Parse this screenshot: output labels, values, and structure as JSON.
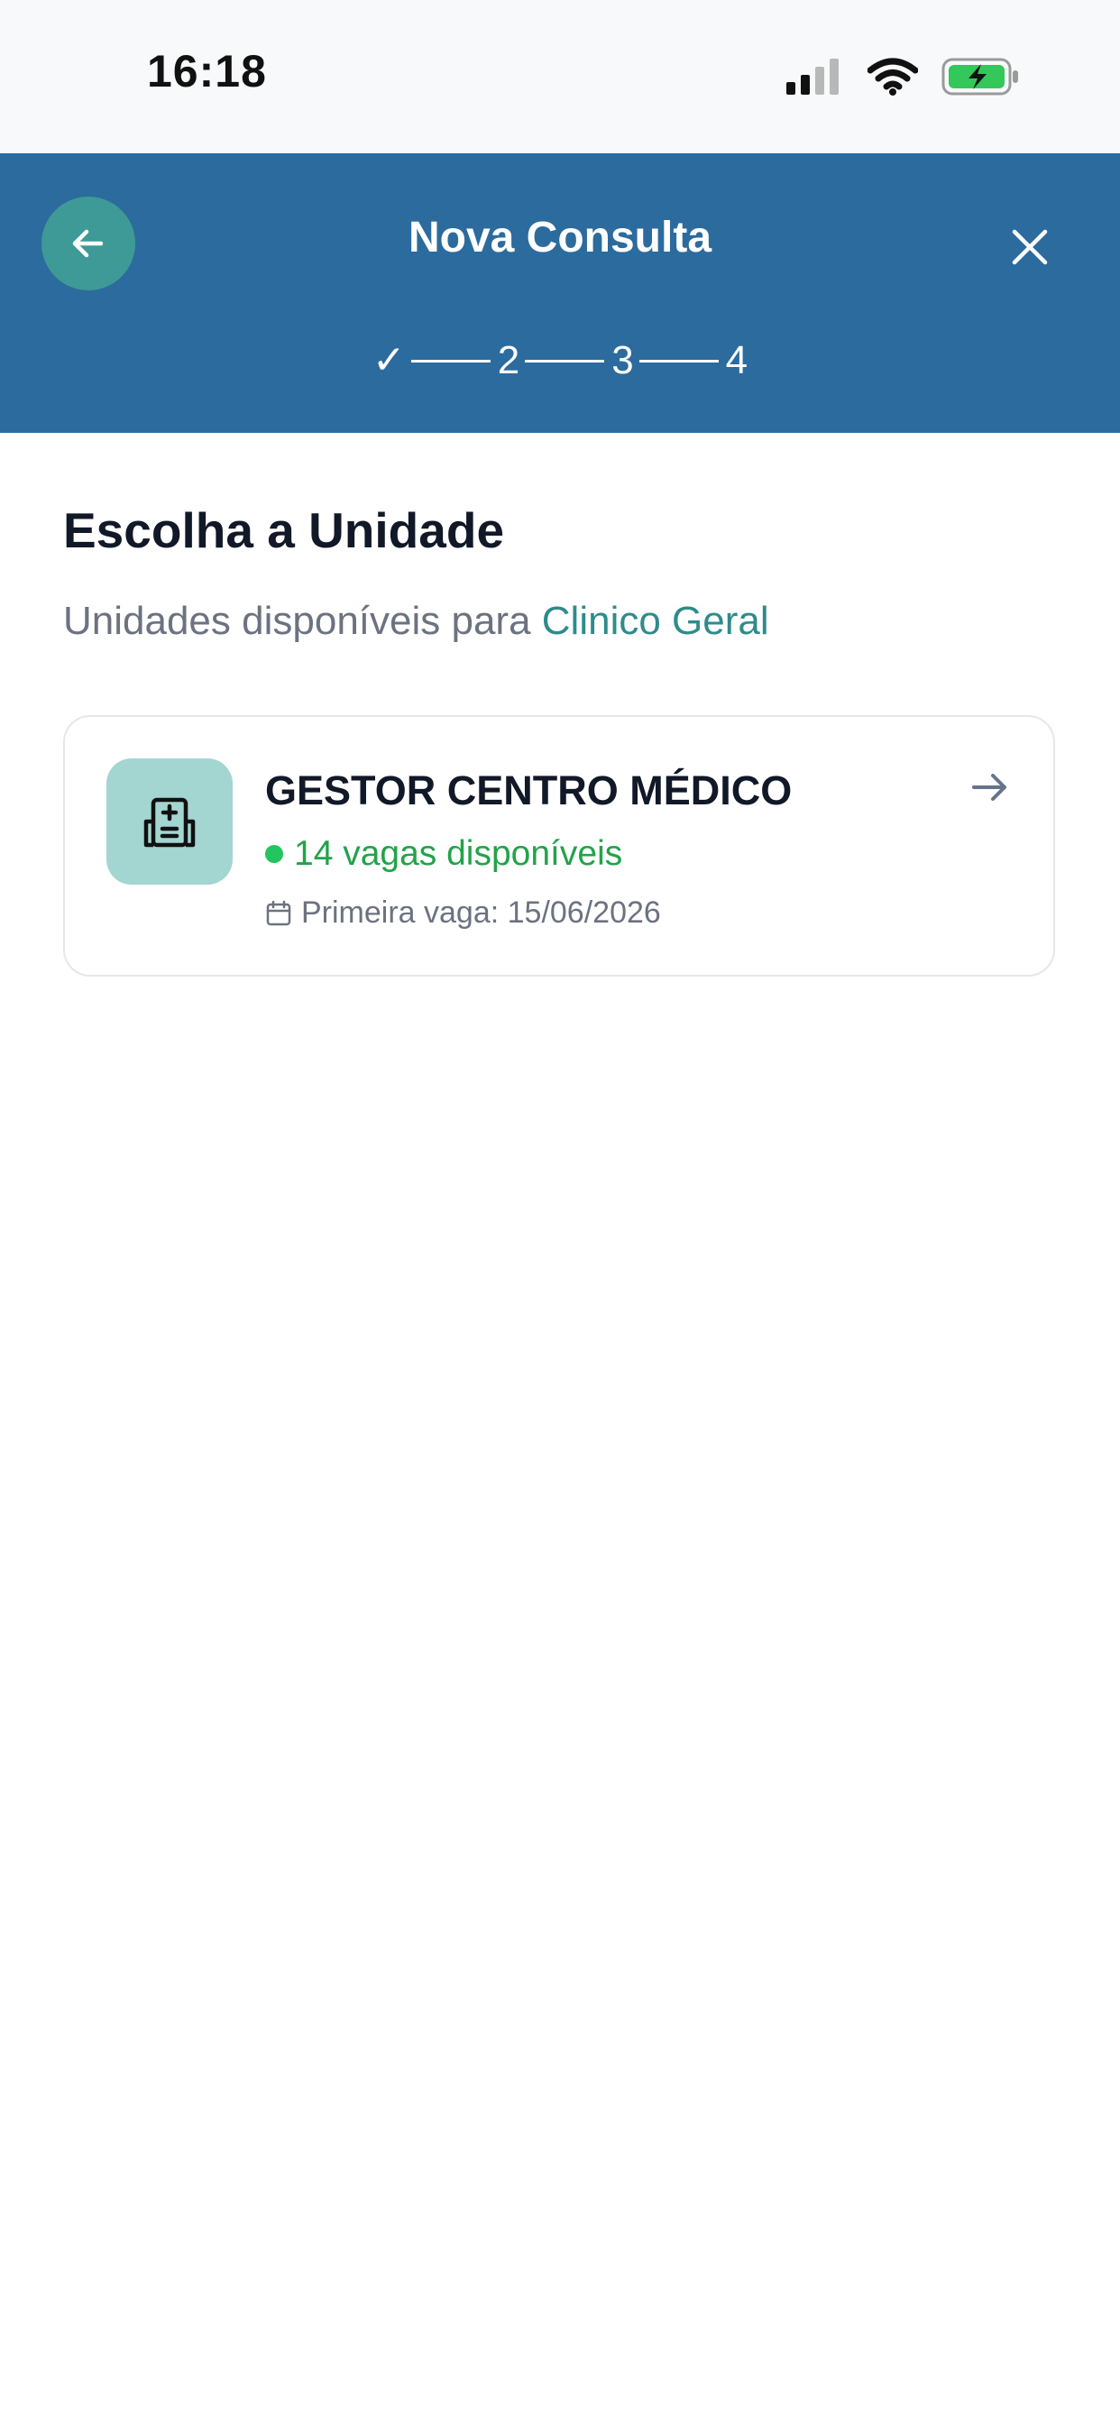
{
  "status_bar": {
    "time": "16:18",
    "icons": [
      "cellular-signal-icon",
      "wifi-icon",
      "battery-charging-icon"
    ]
  },
  "header": {
    "title": "Nova Consulta",
    "back_icon": "arrow-left-icon",
    "close_icon": "close-icon",
    "steps": [
      "✓",
      "2",
      "3",
      "4"
    ],
    "background_color": "#2c6b9e",
    "back_button_color": "#3d9a97"
  },
  "main": {
    "title": "Escolha a Unidade",
    "subtitle_prefix": "Unidades disponíveis para ",
    "subtitle_specialty": "Clinico Geral",
    "units": [
      {
        "name": "GESTOR CENTRO MÉDICO",
        "slots": "14 vagas disponíveis",
        "first_slot": "Primeira vaga: 15/06/2026",
        "icon": "hospital-icon",
        "arrow_icon": "arrow-right-icon"
      }
    ]
  },
  "colors": {
    "accent": "#2e8b8b",
    "available": "#22a34a",
    "unit_icon_bg": "#a3d5d1"
  }
}
